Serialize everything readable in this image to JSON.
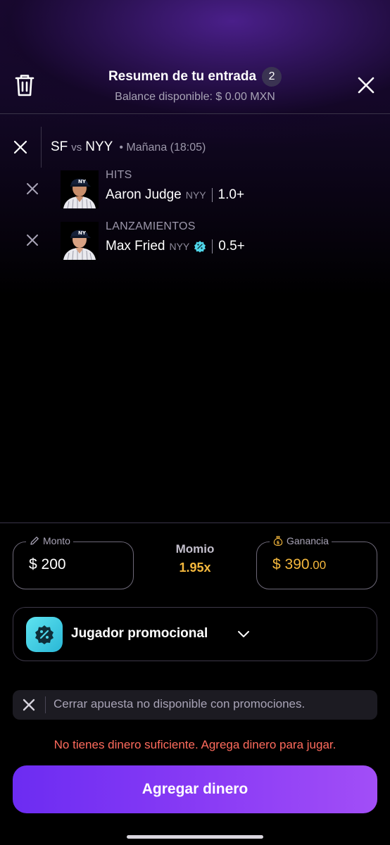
{
  "header": {
    "title": "Resumen de tu entrada",
    "count": "2",
    "balance": "Balance disponible: $ 0.00 MXN"
  },
  "match": {
    "home": "SF",
    "vs": "vs",
    "away": "NYY",
    "time": "• Mañana (18:05)"
  },
  "picks": [
    {
      "category": "HITS",
      "player": "Aaron Judge",
      "team": "NYY",
      "line": "1.0+",
      "promo": false
    },
    {
      "category": "LANZAMIENTOS",
      "player": "Max Fried",
      "team": "NYY",
      "line": "0.5+",
      "promo": true
    }
  ],
  "amount": {
    "label": "Monto",
    "value": "$ 200"
  },
  "momio": {
    "label": "Momio",
    "value": "1.95x"
  },
  "gain": {
    "label": "Ganancia",
    "value": "$ 390",
    "cents": ".00"
  },
  "promo": {
    "label": "Jugador promocional"
  },
  "notice": {
    "text": "Cerrar apuesta no disponible con promociones."
  },
  "error": "No tienes dinero suficiente. Agrega dinero para jugar.",
  "cta": "Agregar dinero",
  "colors": {
    "accent": "#7b34f4",
    "gain": "#f5b83d",
    "error": "#ff6b5d",
    "promo": "#4fd6ea"
  }
}
